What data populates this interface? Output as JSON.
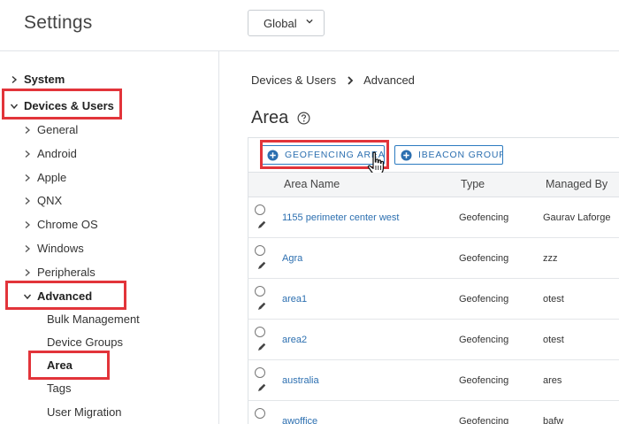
{
  "header": {
    "title": "Settings",
    "scope_select": "Global"
  },
  "sidebar": {
    "items": [
      {
        "label": "System",
        "bold": true
      },
      {
        "label": "Devices & Users",
        "bold": true
      },
      {
        "label": "General"
      },
      {
        "label": "Android"
      },
      {
        "label": "Apple"
      },
      {
        "label": "QNX"
      },
      {
        "label": "Chrome OS"
      },
      {
        "label": "Windows"
      },
      {
        "label": "Peripherals"
      },
      {
        "label": "Advanced"
      },
      {
        "label": "Bulk Management"
      },
      {
        "label": "Device Groups"
      },
      {
        "label": "Area"
      },
      {
        "label": "Tags"
      },
      {
        "label": "User Migration"
      }
    ]
  },
  "main": {
    "breadcrumb": {
      "parent": "Devices & Users",
      "current": "Advanced"
    },
    "title": "Area",
    "toolbar": {
      "geofencing_label": "GEOFENCING AREA",
      "ibeacon_label": "IBEACON GROUP"
    },
    "table": {
      "columns": [
        "Area Name",
        "Type",
        "Managed By"
      ],
      "rows": [
        {
          "name": "1155 perimeter center west",
          "type": "Geofencing",
          "managed_by": "Gaurav Laforge"
        },
        {
          "name": "Agra",
          "type": "Geofencing",
          "managed_by": "zzz"
        },
        {
          "name": "area1",
          "type": "Geofencing",
          "managed_by": "otest"
        },
        {
          "name": "area2",
          "type": "Geofencing",
          "managed_by": "otest"
        },
        {
          "name": "australia",
          "type": "Geofencing",
          "managed_by": "ares"
        },
        {
          "name": "awoffice",
          "type": "Geofencing",
          "managed_by": "bafw"
        }
      ]
    }
  },
  "colors": {
    "link": "#2c6fb0",
    "highlight": "#e2343a",
    "border": "#dde1e5"
  },
  "icons": [
    "chevron-down-icon",
    "caret-right-icon",
    "caret-down-icon",
    "chevron-right-icon",
    "help-icon",
    "plus-circle-icon",
    "pointer-hand-icon",
    "pencil-icon"
  ]
}
